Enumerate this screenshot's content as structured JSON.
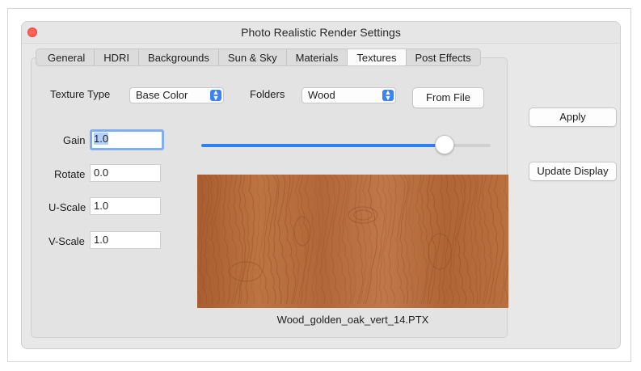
{
  "window": {
    "title": "Photo Realistic Render Settings"
  },
  "tabs": [
    {
      "label": "General",
      "active": false
    },
    {
      "label": "HDRI",
      "active": false
    },
    {
      "label": "Backgrounds",
      "active": false
    },
    {
      "label": "Sun & Sky",
      "active": false
    },
    {
      "label": "Materials",
      "active": false
    },
    {
      "label": "Textures",
      "active": true
    },
    {
      "label": "Post Effects",
      "active": false
    }
  ],
  "texture": {
    "type_label": "Texture Type",
    "type_value": "Base Color",
    "folders_label": "Folders",
    "folders_value": "Wood",
    "from_file_label": "From File"
  },
  "params": {
    "gain_label": "Gain",
    "gain_value": "1.0",
    "rotate_label": "Rotate",
    "rotate_value": "0.0",
    "uscale_label": "U-Scale",
    "uscale_value": "1.0",
    "vscale_label": "V-Scale",
    "vscale_value": "1.0"
  },
  "slider": {
    "value": 0.84
  },
  "preview": {
    "filename": "Wood_golden_oak_vert_14.PTX"
  },
  "actions": {
    "apply_label": "Apply",
    "update_label": "Update Display"
  },
  "colors": {
    "accent": "#2f7ff5",
    "close": "#fe5f57",
    "wood": "#b2673a"
  }
}
